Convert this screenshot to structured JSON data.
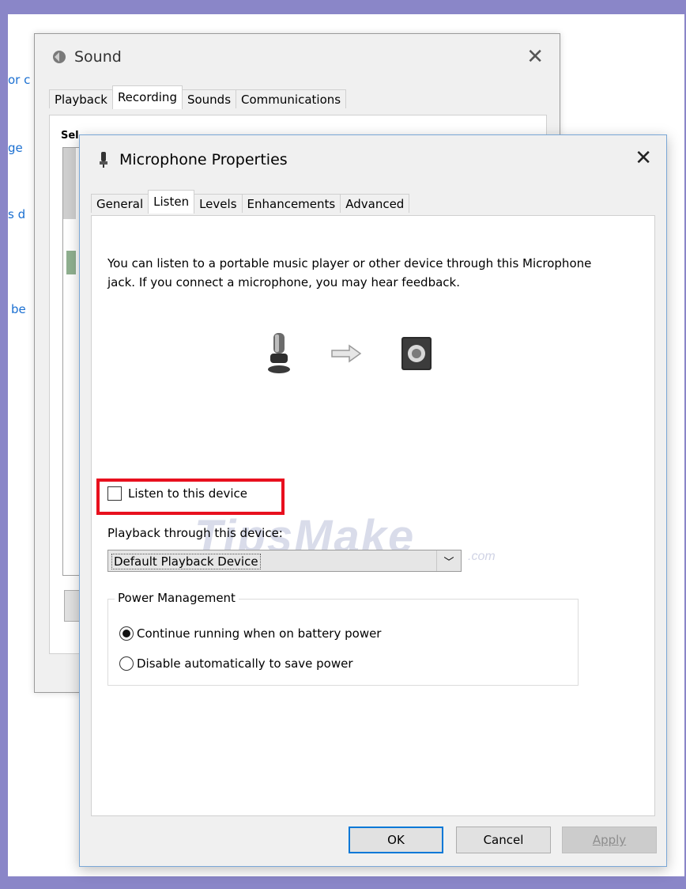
{
  "background_links": [
    "or c",
    "ge",
    "s d",
    "be"
  ],
  "sound_window": {
    "title": "Sound",
    "tabs": [
      "Playback",
      "Recording",
      "Sounds",
      "Communications"
    ],
    "active_tab": "Recording",
    "partial_label": "Sel"
  },
  "dialog": {
    "title": "Microphone Properties",
    "tabs": [
      "General",
      "Listen",
      "Levels",
      "Enhancements",
      "Advanced"
    ],
    "active_tab": "Listen",
    "description": "You can listen to a portable music player or other device through this Microphone jack.  If you connect a microphone, you may hear feedback.",
    "listen_checkbox": {
      "label": "Listen to this device",
      "checked": false
    },
    "playback_label": "Playback through this device:",
    "playback_select": {
      "value": "Default Playback Device"
    },
    "power_group": {
      "label": "Power Management",
      "options": [
        {
          "label": "Continue running when on battery power",
          "selected": true
        },
        {
          "label": "Disable automatically to save power",
          "selected": false
        }
      ]
    },
    "buttons": {
      "ok": "OK",
      "cancel": "Cancel",
      "apply": "Apply"
    }
  },
  "watermark": {
    "text": "TipsMake",
    "suffix": ".com"
  },
  "colors": {
    "frame": "#8a86c8",
    "highlight": "#e8101e",
    "link": "#1a6fd1",
    "default_button_border": "#0078d7"
  }
}
